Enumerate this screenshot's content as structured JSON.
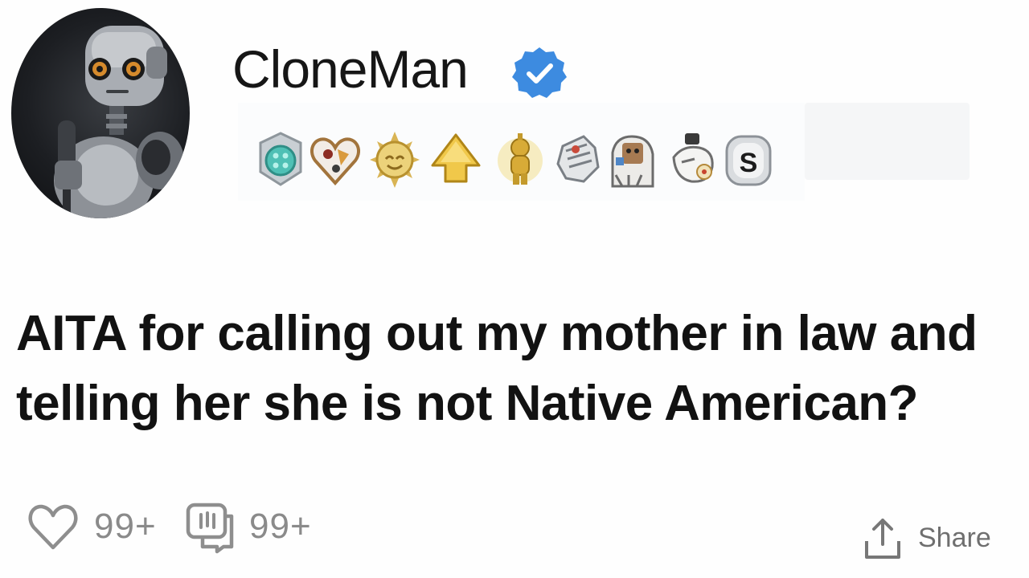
{
  "post": {
    "author": "CloneMan",
    "verified": true,
    "title": "AITA for calling out my mother in law and telling her she is not Native American?",
    "awards": [
      {
        "icon": "teal-medal-icon"
      },
      {
        "icon": "heart-award-icon"
      },
      {
        "icon": "sun-award-icon"
      },
      {
        "icon": "gold-arrow-up-icon"
      },
      {
        "icon": "gold-figure-award-icon"
      },
      {
        "icon": "fist-award-icon"
      },
      {
        "icon": "character-award-icon"
      },
      {
        "icon": "robot-hand-award-icon"
      },
      {
        "icon": "silver-s-award-icon"
      }
    ]
  },
  "actions": {
    "likes": "99+",
    "comments": "99+",
    "share_label": "Share"
  },
  "colors": {
    "verified": "#3d8be0",
    "gold": "#e6c04a",
    "counts": "#8a8a8a"
  }
}
